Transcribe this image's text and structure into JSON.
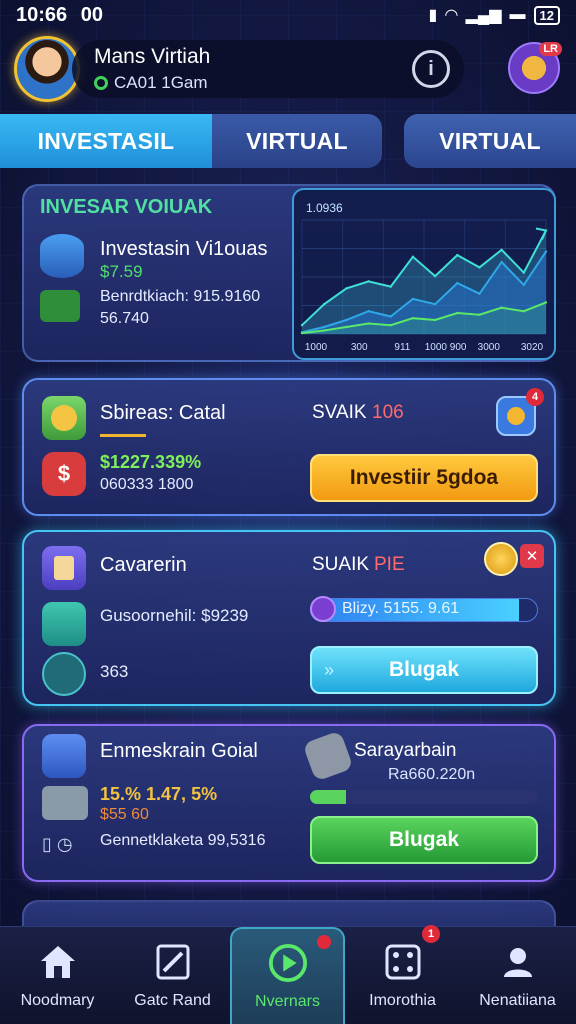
{
  "status_bar": {
    "time": "10:66",
    "extra": "00",
    "battery": "12"
  },
  "profile": {
    "name": "Mans Virtiah",
    "subtitle": "CA01 1Gam",
    "info_glyph": "i",
    "corner_badge": "LR"
  },
  "tabs": [
    {
      "label": "INVESTASIL",
      "active": true
    },
    {
      "label": "VIRTUAL",
      "active": false
    },
    {
      "label": "VIRTUAL",
      "active": false
    }
  ],
  "overview_card": {
    "title": "INVESAR VOIUAK",
    "item_title": "Investasin Vi1ouas",
    "item_value": "$7.59",
    "line1": "Benrdtkiach: 915.9160",
    "line2": "56.740",
    "chart_label": "1.0936"
  },
  "chart_data": {
    "type": "area",
    "title": "1.0936",
    "x": [
      "1000",
      "300",
      "911",
      "1000 900",
      "3000",
      "3020"
    ],
    "series": [
      {
        "values": [
          10,
          34,
          52,
          60,
          54,
          88,
          66,
          90,
          76,
          96,
          70,
          118
        ]
      },
      {
        "values": [
          2,
          8,
          16,
          26,
          20,
          40,
          34,
          58,
          46,
          82,
          56,
          94
        ]
      },
      {
        "values": [
          1,
          4,
          8,
          12,
          10,
          18,
          16,
          24,
          22,
          30,
          26,
          36
        ]
      }
    ],
    "ylim": [
      0,
      130
    ],
    "grid": true
  },
  "card_stocks": {
    "title": "Sbireas: Catal",
    "status_label": "SVAIK",
    "status_value": "106",
    "amount": "$1227.339%",
    "sub": "060333 1800",
    "badge_count": "4",
    "button_label": "Investiir 5gdoa"
  },
  "card_career": {
    "title": "Cavarerin",
    "status_label": "SUAIK",
    "status_value": "PIE",
    "line1": "Gusoornehil: $9239",
    "value": "363",
    "progress_label": "Blizy. 5155. 9.61",
    "progress": 0.92,
    "button_label": "Blugak"
  },
  "card_goal": {
    "title": "Enmeskrain Goial",
    "right_title": "Sarayarbain",
    "right_value": "Ra660.220n",
    "percent": "15.% 1.47, 5%",
    "amount": "$55 60",
    "line": "Gennetklaketa 99,5316",
    "progress": 0.16,
    "button_label": "Blugak"
  },
  "bottom_nav": [
    {
      "label": "Noodmary",
      "icon": "home-icon"
    },
    {
      "label": "Gatc Rand",
      "icon": "cards-icon"
    },
    {
      "label": "Nvernars",
      "icon": "play-icon",
      "active": true
    },
    {
      "label": "Imorothia",
      "icon": "dice-icon",
      "badge": "1"
    },
    {
      "label": "Nenatiiana",
      "icon": "profile-icon"
    }
  ]
}
